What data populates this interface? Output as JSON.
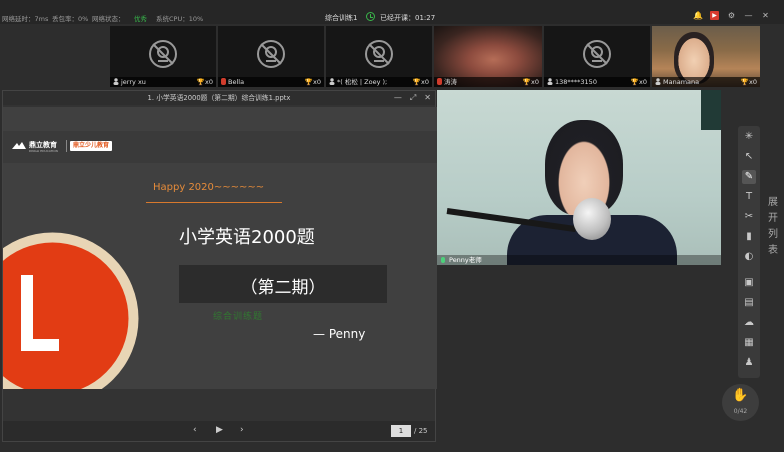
{
  "status_bar": {
    "latency": "网络延时：7ms",
    "packet_loss": "丢包率：0%",
    "network_label": "网络状态：",
    "network_value": "优秀",
    "cpu": "系统CPU：10%",
    "class_name": "综合训练1",
    "elapsed": "已经开课：01:27"
  },
  "window_controls": {
    "bell": "bell-icon",
    "record": "record-icon",
    "settings": "gear-icon",
    "minimize": "minimize-icon",
    "close": "close-icon"
  },
  "students": [
    {
      "name": "jerry xu",
      "score": "x0",
      "camera": "off"
    },
    {
      "name": "Bella",
      "score": "x0",
      "camera": "off"
    },
    {
      "name": "*( 松松 | Zoey );",
      "score": "x0",
      "camera": "off"
    },
    {
      "name": "涛涛",
      "score": "x0",
      "camera": "on"
    },
    {
      "name": "138****3150",
      "score": "x0",
      "camera": "off"
    },
    {
      "name": "Manamana",
      "score": "x0",
      "camera": "on"
    }
  ],
  "document": {
    "title": "1. 小学英语2000题（第二期）综合训练1.pptx",
    "page_current": "1",
    "page_total": "/ 25"
  },
  "slide": {
    "logo_text": "鼎立教育",
    "logo_sub": "DINGLI EDUCATION",
    "logo_badge": "鼎立少儿教育",
    "happy": "Happy 2020~~~~~~",
    "title": "小学英语2000题",
    "issue": "（第二期）",
    "green_note": "综合训练题",
    "author": "— Penny"
  },
  "teacher": {
    "name": "Penny老师"
  },
  "sidebar": {
    "expand_label": "展开列表"
  },
  "raise_hand": {
    "count": "0/42"
  }
}
